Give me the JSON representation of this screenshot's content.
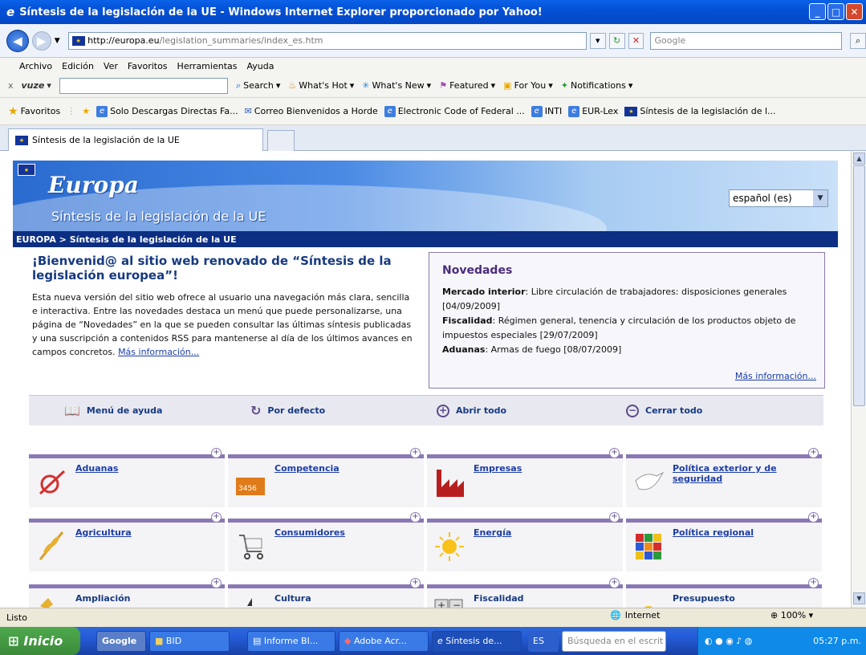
{
  "window": {
    "title": "Síntesis de la legislación de la UE - Windows Internet Explorer proporcionado por Yahoo!"
  },
  "address": {
    "url_host": "http://europa.eu",
    "url_path": "/legislation_summaries/index_es.htm",
    "search_placeholder": "Google"
  },
  "menu": [
    "Archivo",
    "Edición",
    "Ver",
    "Favoritos",
    "Herramientas",
    "Ayuda"
  ],
  "vuze": {
    "brand": "vuze",
    "search": "Search",
    "whats_hot": "What's Hot",
    "whats_new": "What's New",
    "featured": "Featured",
    "for_you": "For You",
    "notifications": "Notifications"
  },
  "favorites": {
    "label": "Favoritos",
    "items": [
      "Solo Descargas Directas Fa...",
      "Correo Bienvenidos a Horde",
      "Electronic Code of Federal ...",
      "INTI",
      "EUR-Lex",
      "Síntesis de la legislación de l..."
    ]
  },
  "tab": {
    "label": "Síntesis de la legislación de la UE"
  },
  "banner": {
    "logo": "Europa",
    "subtitle": "Síntesis de la legislación de la UE",
    "language": "español (es)"
  },
  "breadcrumb": "EUROPA > Síntesis de la legislación de la UE",
  "welcome": {
    "title": "¡Bienvenid@ al sitio web renovado de “Síntesis de la legislación europea”!",
    "body": "Esta nueva versión del sitio web ofrece al usuario una navegación más clara, sencilla e interactiva. Entre las novedades destaca un menú que puede personalizarse, una página de “Novedades” en la que se pueden consultar las últimas síntesis publicadas y una suscripción a contenidos RSS para mantenerse al día de los últimos avances en campos concretos.",
    "link": "Más información..."
  },
  "news": {
    "title": "Novedades",
    "items": [
      {
        "topic": "Mercado interior",
        "text": ": Libre circulación de trabajadores: disposiciones generales [04/09/2009]"
      },
      {
        "topic": "Fiscalidad",
        "text": ": Régimen general, tenencia y circulación de los productos objeto de impuestos especiales [29/07/2009]"
      },
      {
        "topic": "Aduanas",
        "text": ": Armas de fuego [08/07/2009]"
      }
    ],
    "more": "Más información..."
  },
  "tools": {
    "help": "Menú de ayuda",
    "default": "Por defecto",
    "open_all": "Abrir todo",
    "close_all": "Cerrar todo"
  },
  "categories": [
    "Aduanas",
    "Competencia",
    "Empresas",
    "Política exterior y de seguridad",
    "Agricultura",
    "Consumidores",
    "Energía",
    "Política regional",
    "Ampliación",
    "Cultura",
    "Fiscalidad",
    "Presupuesto"
  ],
  "status": {
    "text": "Listo",
    "zone": "Internet",
    "zoom": "100%"
  },
  "taskbar": {
    "start": "Inicio",
    "google": "Google",
    "items": [
      "BID",
      "Informe BI...",
      "Adobe Acr...",
      "Síntesis de..."
    ],
    "lang": "ES",
    "search_placeholder": "Búsqueda en el escrit",
    "clock": "05:27 p.m."
  }
}
